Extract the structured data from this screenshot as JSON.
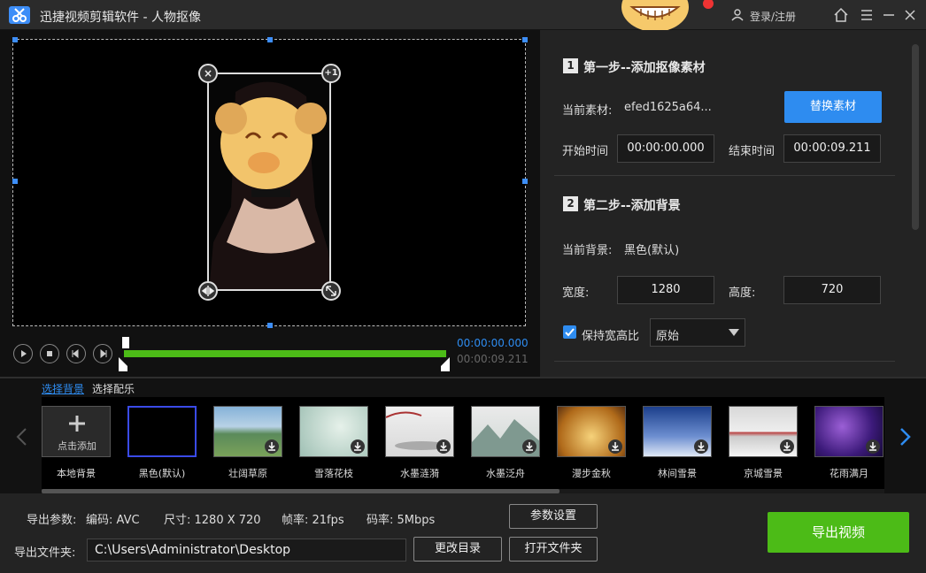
{
  "titlebar": {
    "title": "迅捷视频剪辑软件 - 人物抠像",
    "login": "登录/注册"
  },
  "preview": {
    "time_current": "00:00:00.000",
    "time_total": "00:00:09.211",
    "overlay_buttons": {
      "close": "×",
      "plus_one": "+1"
    },
    "progress_fraction": 1.0
  },
  "step1": {
    "num": "1",
    "title": "第一步--添加抠像素材",
    "current_label": "当前素材:",
    "current_value": "efed1625a64...",
    "replace_button": "替换素材",
    "start_label": "开始时间",
    "start_value": "00:00:00.000",
    "end_label": "结束时间",
    "end_value": "00:00:09.211"
  },
  "step2": {
    "num": "2",
    "title": "第二步--添加背景",
    "current_label": "当前背景:",
    "current_value": "黑色(默认)",
    "width_label": "宽度:",
    "width_value": "1280",
    "height_label": "高度:",
    "height_value": "720",
    "keep_ratio_label": "保持宽高比",
    "keep_ratio_checked": true,
    "ratio_option": "原始"
  },
  "library": {
    "tabs": [
      "选择背景",
      "选择配乐"
    ],
    "add_label": "点击添加",
    "items": [
      "本地背景",
      "黑色(默认)",
      "壮阔草原",
      "雪落花枝",
      "水墨涟漪",
      "水墨泛舟",
      "漫步金秋",
      "林间雪景",
      "京城雪景",
      "花雨满月"
    ]
  },
  "export": {
    "params_label": "导出参数:",
    "codec": "编码:  AVC",
    "size": "尺寸:  1280 X 720",
    "fps": "帧率:  21fps",
    "bitrate": "码率:  5Mbps",
    "settings_button": "参数设置",
    "folder_label": "导出文件夹:",
    "folder_path": "C:\\Users\\Administrator\\Desktop",
    "change_dir_button": "更改目录",
    "open_folder_button": "打开文件夹",
    "export_button": "导出视频"
  },
  "colors": {
    "accent_blue": "#2e8cf0",
    "accent_green": "#4cbb17"
  }
}
